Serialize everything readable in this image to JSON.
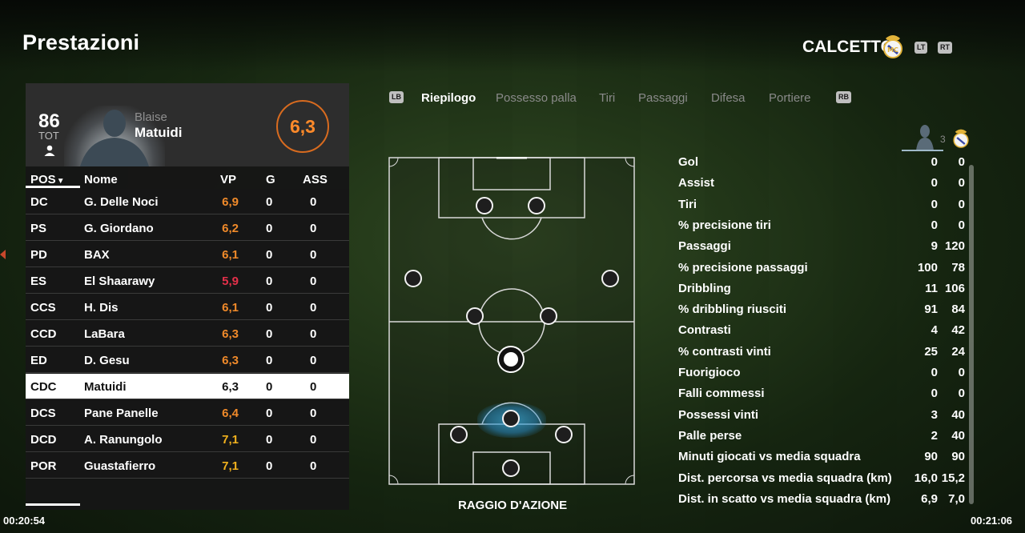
{
  "header": {
    "title": "Prestazioni",
    "team_name": "CALCETTO",
    "lt": "LT",
    "rt": "RT"
  },
  "player": {
    "overall": "86",
    "overall_label": "TOT",
    "first_name": "Blaise",
    "last_name": "Matuidi",
    "rating": "6,3"
  },
  "table": {
    "columns": [
      "POS",
      "Nome",
      "VP",
      "G",
      "ASS"
    ],
    "rows": [
      {
        "pos": "DC",
        "name": "G. Delle Noci",
        "vp": "6,9",
        "g": "0",
        "ass": "0",
        "vp_color": "#f08a2a"
      },
      {
        "pos": "PS",
        "name": "G. Giordano",
        "vp": "6,2",
        "g": "0",
        "ass": "0",
        "vp_color": "#f08a2a"
      },
      {
        "pos": "PD",
        "name": "BAX",
        "vp": "6,1",
        "g": "0",
        "ass": "0",
        "vp_color": "#f08a2a"
      },
      {
        "pos": "ES",
        "name": "El Shaarawy",
        "vp": "5,9",
        "g": "0",
        "ass": "0",
        "vp_color": "#e5304a"
      },
      {
        "pos": "CCS",
        "name": "H. Dis",
        "vp": "6,1",
        "g": "0",
        "ass": "0",
        "vp_color": "#f08a2a"
      },
      {
        "pos": "CCD",
        "name": "LaBara",
        "vp": "6,3",
        "g": "0",
        "ass": "0",
        "vp_color": "#f08a2a"
      },
      {
        "pos": "ED",
        "name": "D. Gesu",
        "vp": "6,3",
        "g": "0",
        "ass": "0",
        "vp_color": "#f08a2a"
      },
      {
        "pos": "CDC",
        "name": "Matuidi",
        "vp": "6,3",
        "g": "0",
        "ass": "0",
        "vp_color": "#111111",
        "selected": true
      },
      {
        "pos": "DCS",
        "name": "Pane Panelle",
        "vp": "6,4",
        "g": "0",
        "ass": "0",
        "vp_color": "#f08a2a"
      },
      {
        "pos": "DCD",
        "name": "A. Ranungolo",
        "vp": "7,1",
        "g": "0",
        "ass": "0",
        "vp_color": "#f2b21e"
      },
      {
        "pos": "POR",
        "name": "Guastafierro",
        "vp": "7,1",
        "g": "0",
        "ass": "0",
        "vp_color": "#f2b21e"
      }
    ]
  },
  "tabs": {
    "lb": "LB",
    "rb": "RB",
    "items": [
      "Riepilogo",
      "Possesso palla",
      "Tiri",
      "Passaggi",
      "Difesa",
      "Portiere"
    ],
    "active": 0
  },
  "pitch": {
    "label": "RAGGIO D'AZIONE"
  },
  "stats": {
    "compare_count": "3",
    "rows": [
      {
        "label": "Gol",
        "a": "0",
        "b": "0"
      },
      {
        "label": "Assist",
        "a": "0",
        "b": "0"
      },
      {
        "label": "Tiri",
        "a": "0",
        "b": "0"
      },
      {
        "label": "% precisione tiri",
        "a": "0",
        "b": "0"
      },
      {
        "label": "Passaggi",
        "a": "9",
        "b": "120"
      },
      {
        "label": "% precisione passaggi",
        "a": "100",
        "b": "78"
      },
      {
        "label": "Dribbling",
        "a": "11",
        "b": "106"
      },
      {
        "label": "% dribbling riusciti",
        "a": "91",
        "b": "84"
      },
      {
        "label": "Contrasti",
        "a": "4",
        "b": "42"
      },
      {
        "label": "% contrasti vinti",
        "a": "25",
        "b": "24"
      },
      {
        "label": "Fuorigioco",
        "a": "0",
        "b": "0"
      },
      {
        "label": "Falli commessi",
        "a": "0",
        "b": "0"
      },
      {
        "label": "Possessi vinti",
        "a": "3",
        "b": "40"
      },
      {
        "label": "Palle perse",
        "a": "2",
        "b": "40"
      },
      {
        "label": "Minuti giocati vs media squadra",
        "a": "90",
        "b": "90"
      },
      {
        "label": "Dist. percorsa vs media squadra (km)",
        "a": "16,0",
        "b": "15,2"
      },
      {
        "label": "Dist. in scatto vs media squadra (km)",
        "a": "6,9",
        "b": "7,0"
      }
    ]
  },
  "footer": {
    "time_left": "00:20:54",
    "time_right": "00:21:06"
  },
  "colors": {
    "rating_orange": "#ff8a2a",
    "panel_bg": "#161616",
    "selected_row": "#ffffff"
  }
}
